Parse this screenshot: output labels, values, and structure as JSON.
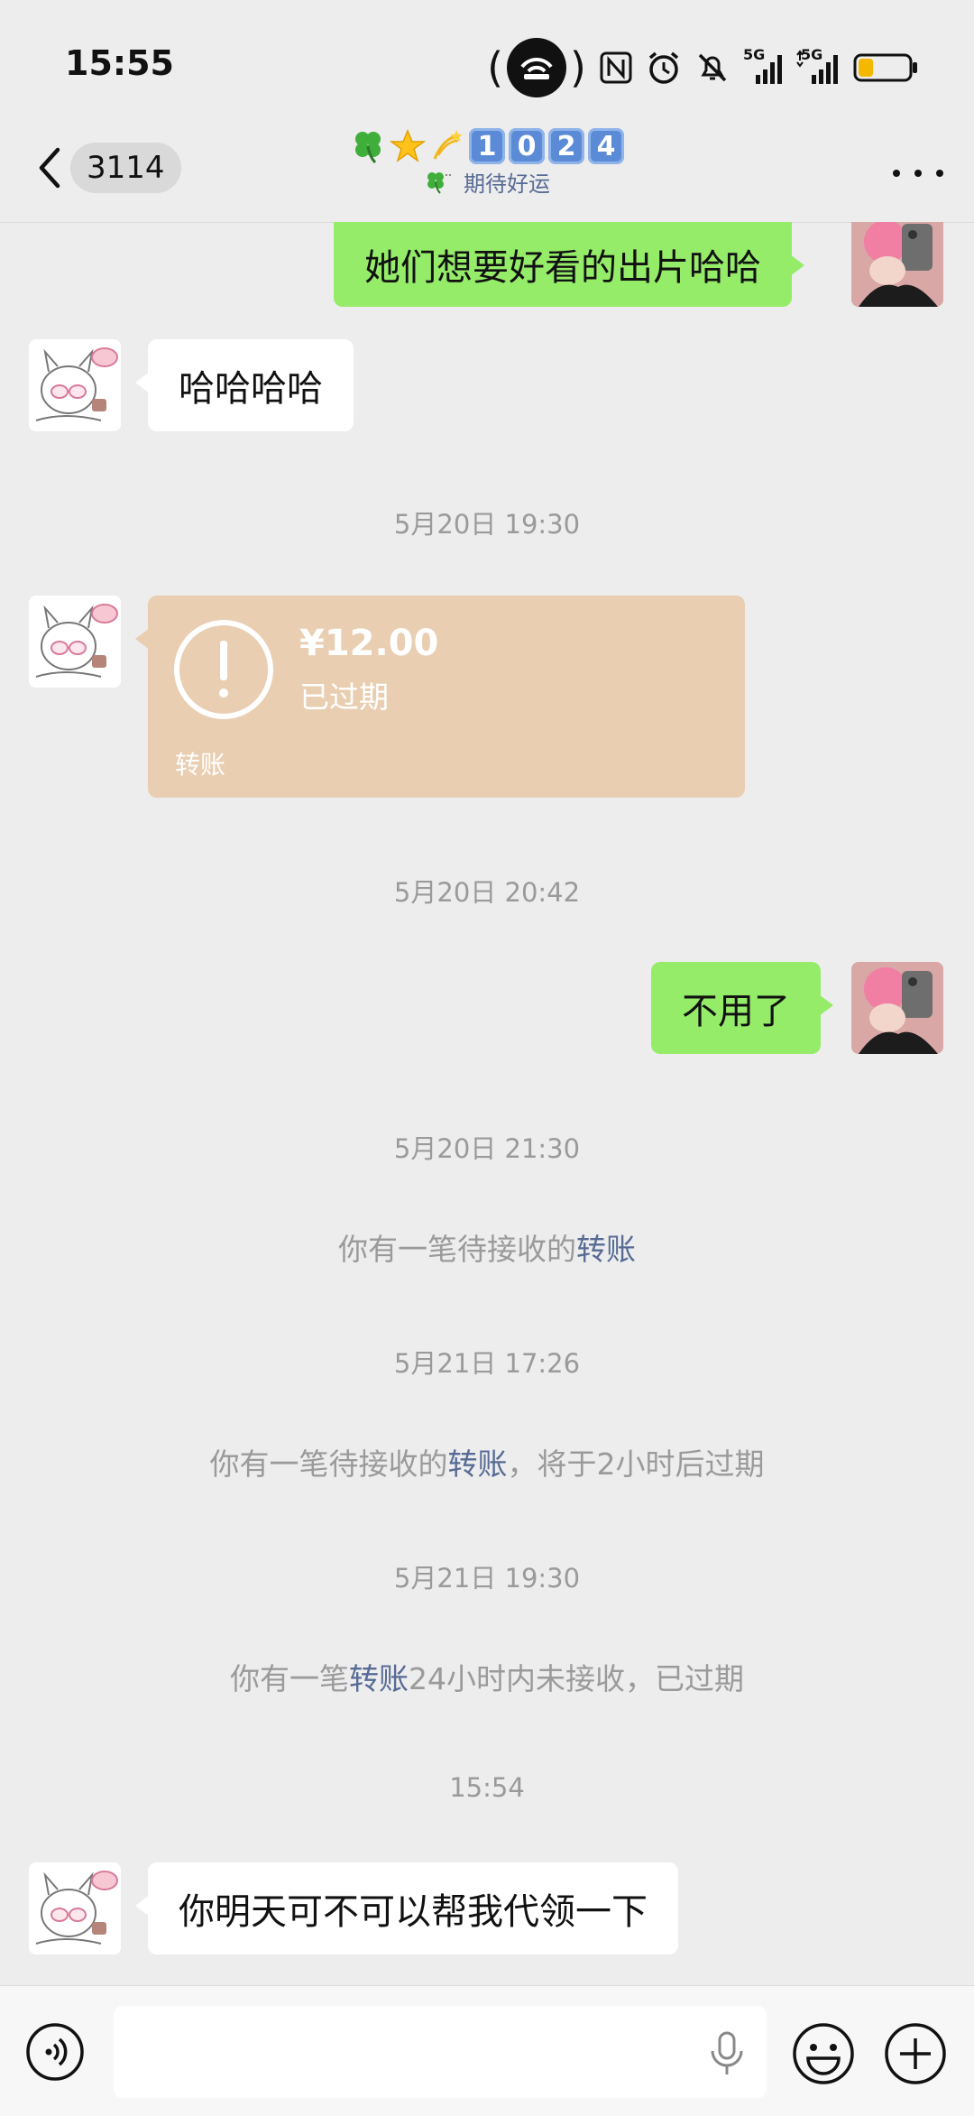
{
  "status_bar": {
    "time": "15:55",
    "signal_1_label": "5G",
    "signal_2_label": "5G",
    "battery_level_percent": 30,
    "battery_color": "#f5b800"
  },
  "nav": {
    "unread_count": "3114",
    "title_digits": [
      "1",
      "0",
      "2",
      "4"
    ],
    "subtitle": "期待好运"
  },
  "messages": {
    "m1": {
      "text": "她们想要好看的出片哈哈"
    },
    "m2": {
      "text": "哈哈哈哈"
    },
    "ts1": "5月20日 19:30",
    "transfer": {
      "amount": "¥12.00",
      "status": "已过期",
      "label": "转账"
    },
    "ts2": "5月20日 20:42",
    "m3": {
      "text": "不用了"
    },
    "ts3": "5月20日 21:30",
    "sys1": {
      "pre": "你有一笔待接收的",
      "link": "转账",
      "post": ""
    },
    "ts4": "5月21日 17:26",
    "sys2": {
      "pre": "你有一笔待接收的",
      "link": "转账",
      "post": "，将于2小时后过期"
    },
    "ts5": "5月21日 19:30",
    "sys3": {
      "pre": "你有一笔",
      "link": "转账",
      "post": "24小时内未接收，已过期"
    },
    "ts6": "15:54",
    "m4": {
      "text": "你明天可不可以帮我代领一下"
    }
  },
  "colors": {
    "outgoing_bubble": "#95ec69",
    "incoming_bubble": "#ffffff",
    "transfer_card": "#e9ceb2",
    "link": "#576b95",
    "background": "#ededed"
  }
}
